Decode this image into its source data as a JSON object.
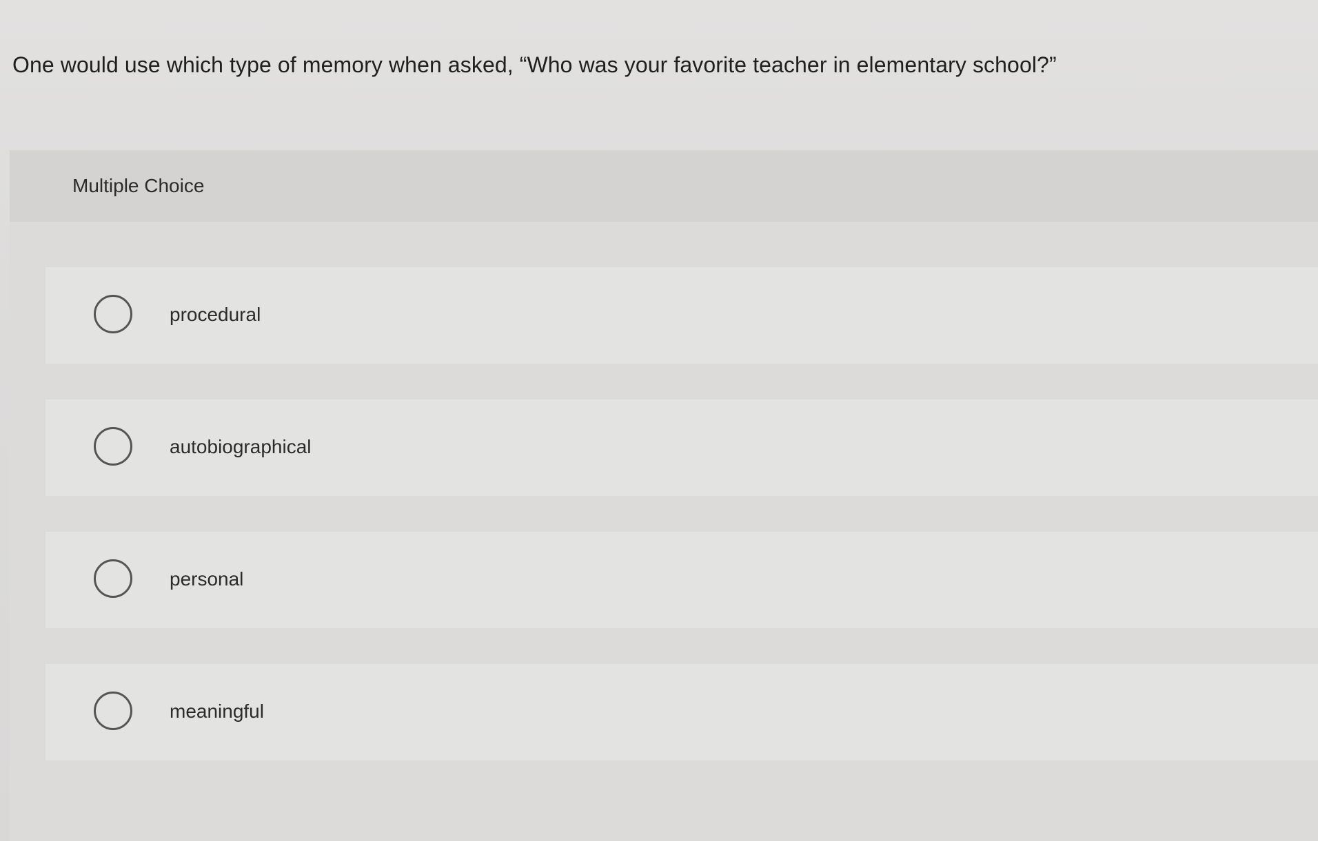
{
  "question": {
    "text": "One would use which type of memory when asked, “Who was your favorite teacher in elementary school?”"
  },
  "panel": {
    "title": "Multiple Choice"
  },
  "choices": [
    {
      "label": "procedural",
      "selected": false
    },
    {
      "label": "autobiographical",
      "selected": false
    },
    {
      "label": "personal",
      "selected": false
    },
    {
      "label": "meaningful",
      "selected": false
    }
  ]
}
